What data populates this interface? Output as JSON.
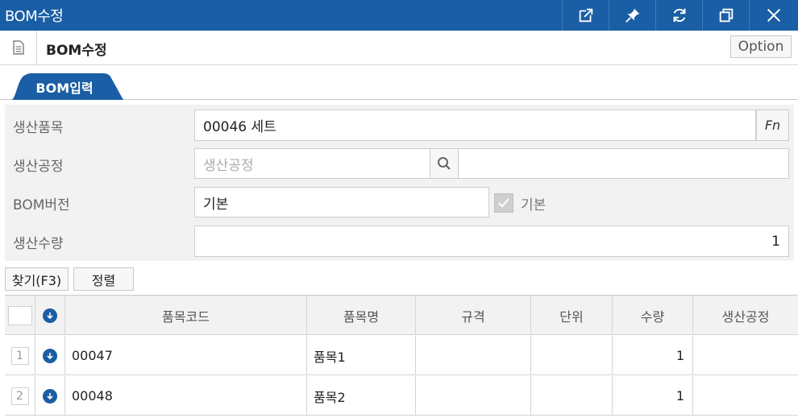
{
  "window": {
    "title": "BOM수정",
    "controls": [
      {
        "name": "popout-icon"
      },
      {
        "name": "pin-icon"
      },
      {
        "name": "refresh-icon"
      },
      {
        "name": "restore-icon"
      },
      {
        "name": "close-icon"
      }
    ]
  },
  "header": {
    "title": "BOM수정",
    "option_label": "Option"
  },
  "tabs": [
    {
      "label": "BOM입력",
      "active": true
    }
  ],
  "form": {
    "product": {
      "label": "생산품목",
      "value": "00046 세트",
      "fn_label": "Fn"
    },
    "process": {
      "label": "생산공정",
      "placeholder": "생산공정",
      "value": ""
    },
    "version": {
      "label": "BOM버전",
      "value": "기본",
      "checkbox_label": "기본",
      "checked": true
    },
    "quantity": {
      "label": "생산수량",
      "value": "1"
    }
  },
  "toolbar": {
    "find_label": "찾기(F3)",
    "sort_label": "정렬"
  },
  "grid": {
    "columns": [
      "품목코드",
      "품목명",
      "규격",
      "단위",
      "수량",
      "생산공정"
    ],
    "rows": [
      {
        "no": "1",
        "code": "00047",
        "name": "품목1",
        "spec": "",
        "unit": "",
        "qty": "1",
        "process": ""
      },
      {
        "no": "2",
        "code": "00048",
        "name": "품목2",
        "spec": "",
        "unit": "",
        "qty": "1",
        "process": ""
      }
    ]
  },
  "colors": {
    "titlebar": "#1a5ea5",
    "accent": "#1a5ea5",
    "form_bg": "#f2f2f2"
  }
}
